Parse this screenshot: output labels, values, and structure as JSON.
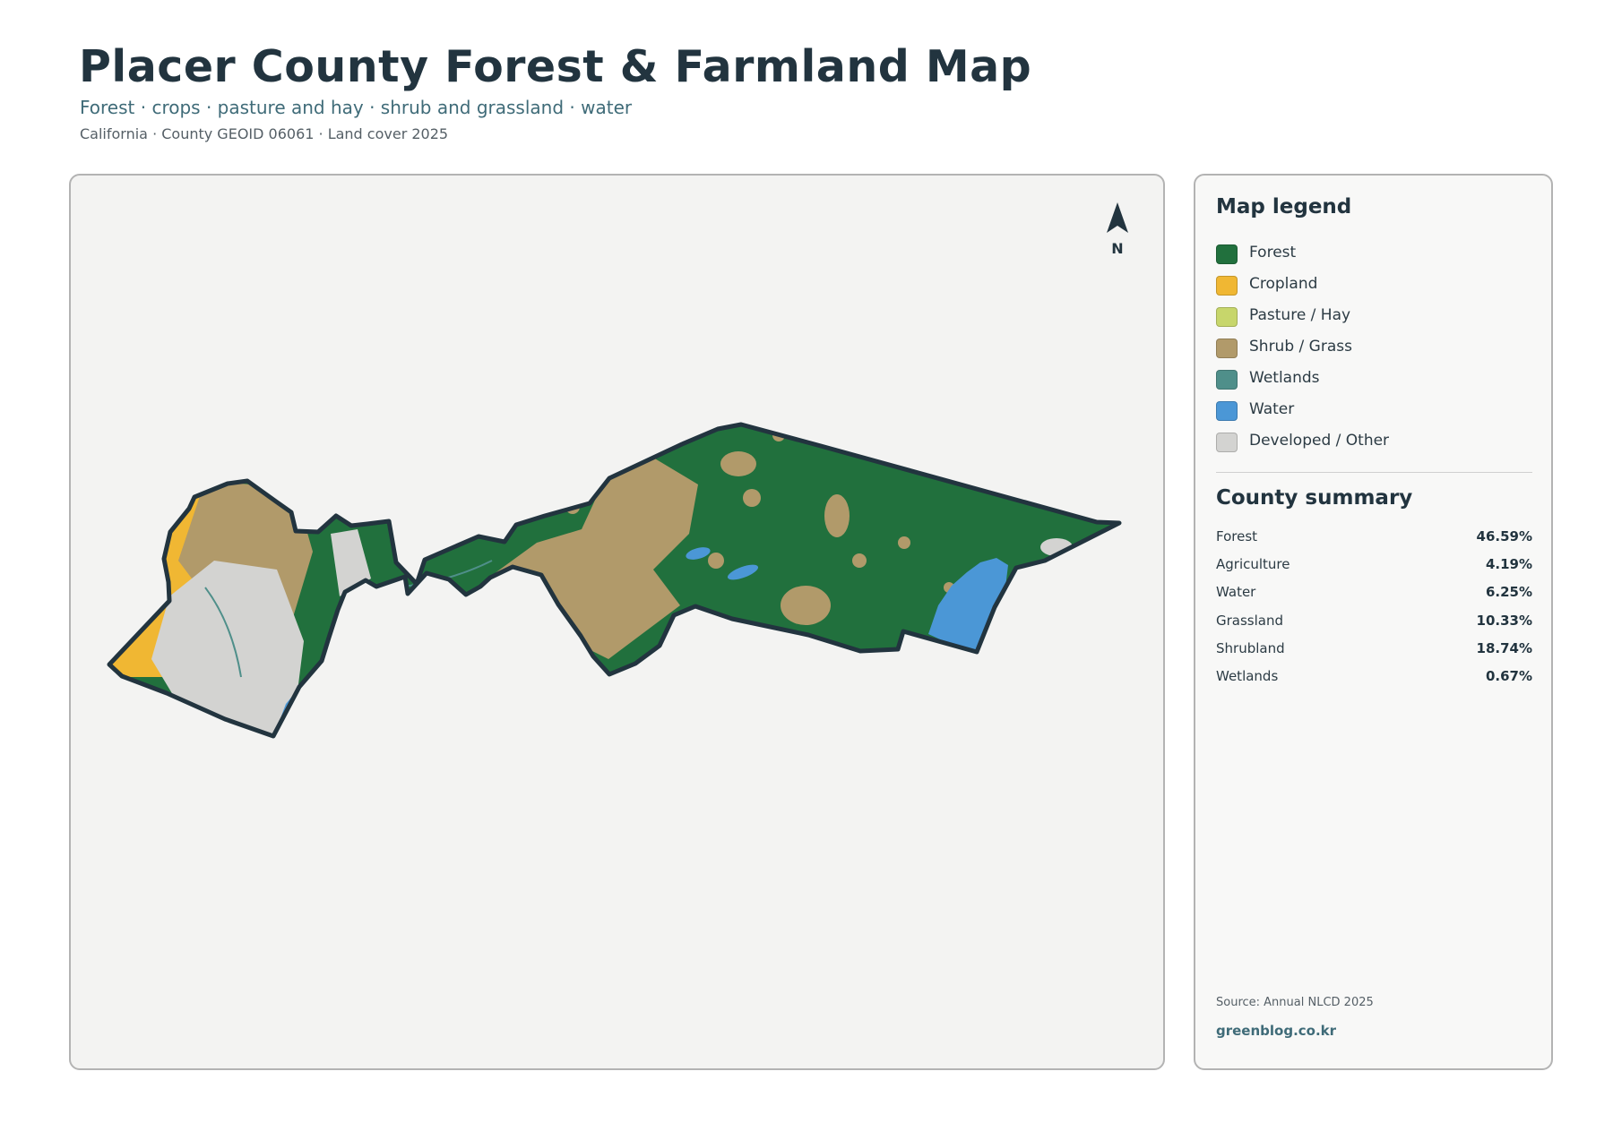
{
  "header": {
    "title": "Placer County Forest & Farmland Map",
    "subtitle": "Forest · crops · pasture and hay · shrub and grassland · water",
    "meta": "California · County GEOID 06061 · Land cover 2025"
  },
  "map": {
    "north_label": "N",
    "colors": {
      "forest": "#21703d",
      "cropland": "#f0b733",
      "pasture": "#c7d66b",
      "shrub": "#b19a6a",
      "wetlands": "#4f8f8a",
      "water": "#4b97d6",
      "developed": "#d3d3d1",
      "outline": "#22343f"
    }
  },
  "legend": {
    "heading": "Map legend",
    "items": [
      {
        "label": "Forest",
        "color": "#21703d"
      },
      {
        "label": "Cropland",
        "color": "#f0b733"
      },
      {
        "label": "Pasture / Hay",
        "color": "#c7d66b"
      },
      {
        "label": "Shrub / Grass",
        "color": "#b19a6a"
      },
      {
        "label": "Wetlands",
        "color": "#4f8f8a"
      },
      {
        "label": "Water",
        "color": "#4b97d6"
      },
      {
        "label": "Developed / Other",
        "color": "#d3d3d1"
      }
    ]
  },
  "summary": {
    "heading": "County summary",
    "rows": [
      {
        "label": "Forest",
        "value": "46.59%"
      },
      {
        "label": "Agriculture",
        "value": "4.19%"
      },
      {
        "label": "Water",
        "value": "6.25%"
      },
      {
        "label": "Grassland",
        "value": "10.33%"
      },
      {
        "label": "Shrubland",
        "value": "18.74%"
      },
      {
        "label": "Wetlands",
        "value": "0.67%"
      }
    ],
    "source": "Source: Annual NLCD 2025",
    "site": "greenblog.co.kr"
  }
}
